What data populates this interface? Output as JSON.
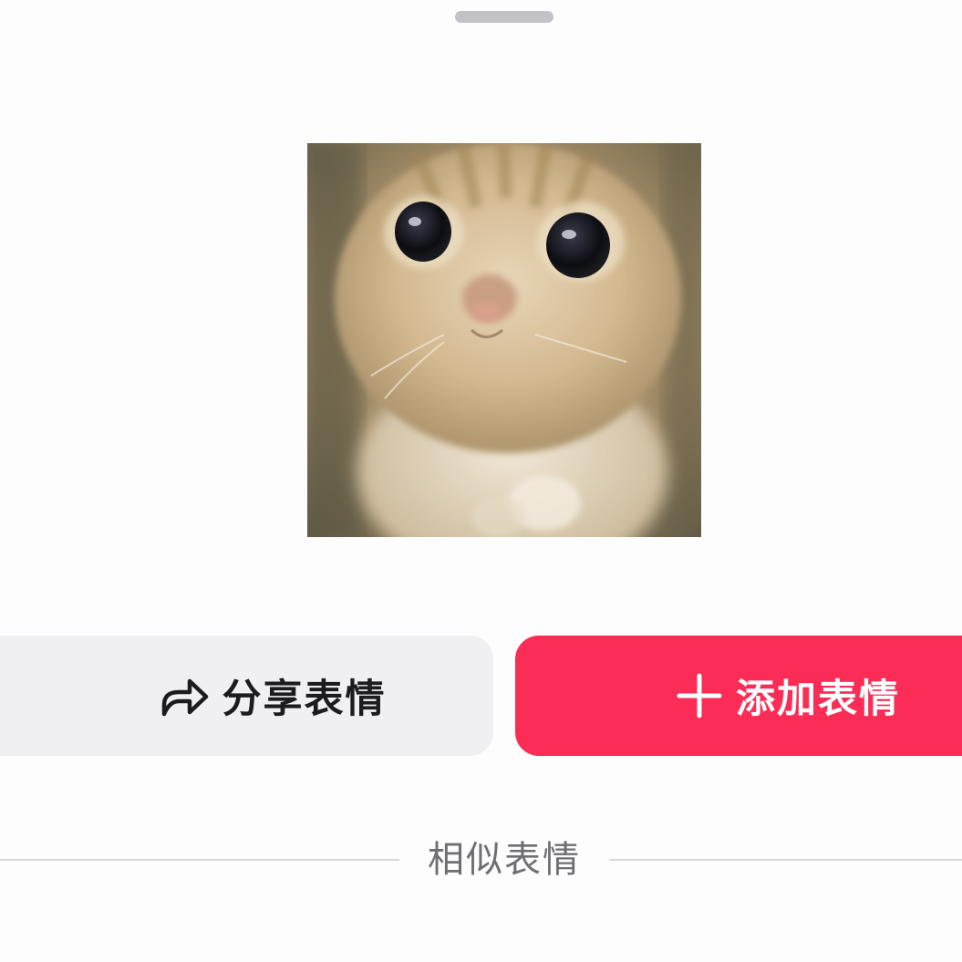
{
  "sheet": {
    "grabber_color": "#c2c2c7"
  },
  "preview": {
    "subject": "kitten-sticker"
  },
  "actions": {
    "share": {
      "label": "分享表情",
      "icon": "share-arrow-icon"
    },
    "add": {
      "label": "添加表情",
      "icon": "plus-icon",
      "color": "#fb2c56"
    }
  },
  "similar": {
    "heading": "相似表情"
  }
}
